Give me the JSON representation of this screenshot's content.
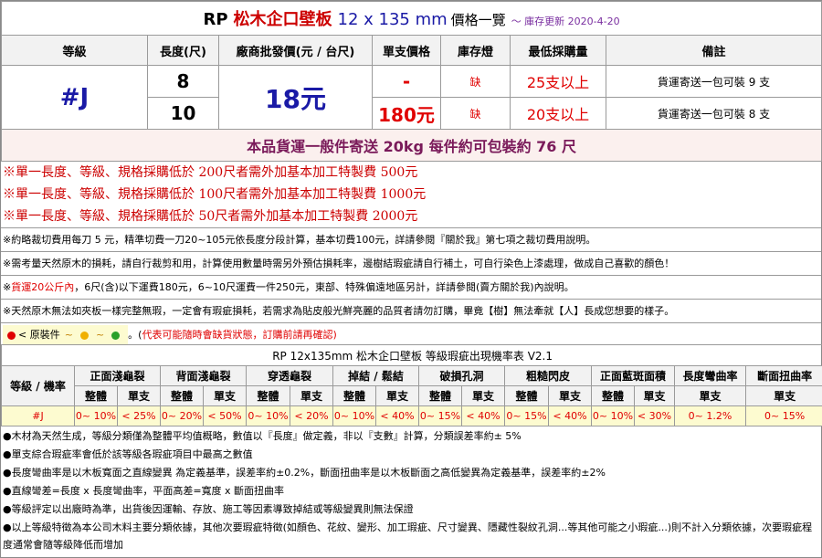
{
  "title": {
    "brand": "RP",
    "product": "松木企口壁板",
    "size": "12 x 135 mm",
    "suffix": "價格一覽",
    "date": "～ 庫存更新 2020-4-20"
  },
  "headers": [
    "等級",
    "長度(尺)",
    "廠商批發價(元 / 台尺)",
    "單支價格",
    "庫存燈",
    "最低採購量",
    "備註"
  ],
  "grade": "#J",
  "price_per_unit": "18元",
  "rows": [
    {
      "length": "8",
      "unit_price": "-",
      "stock": "缺",
      "min_qty": "25支以上",
      "note": "貨運寄送一包可裝 9 支"
    },
    {
      "length": "10",
      "unit_price": "180元",
      "stock": "缺",
      "min_qty": "20支以上",
      "note": "貨運寄送一包可裝 8 支"
    }
  ],
  "shipping": "本品貨運一般件寄送 20kg 每件約可包裝約 76 尺",
  "red_notes": [
    "※單一長度、等級、規格採購低於 200尺者需外加基本加工特製費 500元",
    "※單一長度、等級、規格採購低於 100尺者需外加基本加工特製費 1000元",
    "※單一長度、等級、規格採購低於  50尺者需外加基本加工特製費 2000元"
  ],
  "small_notes": [
    "※約略裁切費用每刀 5 元，精準切費一刀20~105元依長度分段計算，基本切費100元，詳請參閱『關於我』第七項之裁切費用說明。",
    "※需考量天然原木的損耗，請自行裁剪和用，計算使用數量時需另外預估損耗率，邊樹結瑕疵請自行補土，可自行染色上漆處理，做成自己喜歡的顏色！"
  ],
  "shipping_note": {
    "prefix": "※",
    "red": "貨運20公斤內",
    "rest": "，6尺(含)以下運費180元，6~10尺運費一件250元，東部、特殊偏遠地區另計，詳請參閱(賣方關於我)內說明。"
  },
  "wood_note": "※天然原木無法如夾板一樣完整無瑕，一定會有瑕疵損耗，若需求為貼皮般光鮮亮麗的品質者請勿訂購，畢竟【樹】無法牽就【人】長成您想要的樣子。",
  "legend": {
    "label": "< 原裝件",
    "tilde": "~",
    "note": "代表可能隨時會缺貨狀態，訂購前請再確認)",
    "note_prefix": "。(",
    "colors": {
      "red": "#e00000",
      "yellow": "#f0b000",
      "green": "#2aa02a"
    }
  },
  "rate_table": {
    "title": "RP 12x135mm 松木企口壁板 等級瑕疵出現機率表 V2.1",
    "grade_header": "等級 / 機率",
    "columns": [
      "正面淺龜裂",
      "背面淺龜裂",
      "穿透龜裂",
      "掉結 / 鬆結",
      "破損孔洞",
      "粗糙閃皮",
      "正面藍斑面積",
      "長度彎曲率",
      "斷面扭曲率"
    ],
    "sub_whole": "整體",
    "sub_single": "單支",
    "grade": "#J",
    "values": [
      "0~ 10%",
      "< 25%",
      "0~ 20%",
      "< 50%",
      "0~ 10%",
      "< 20%",
      "0~ 10%",
      "< 40%",
      "0~ 15%",
      "< 40%",
      "0~ 15%",
      "< 40%",
      "0~ 10%",
      "< 30%",
      "0~ 1.2%",
      "0~ 15%"
    ]
  },
  "footnotes": [
    "●木材為天然生成，等級分類僅為整體平均值概略，數值以『長度』做定義，非以『支數』計算，分類誤差率約± 5%",
    "●單支綜合瑕疵率會低於該等級各瑕疵項目中最高之數值",
    "●長度彎曲率是以木板寬面之直線變異 為定義基準，誤差率約±0.2%，斷面扭曲率是以木板斷面之高低變異為定義基準，誤差率約±2%",
    "●直線彎差=長度 x 長度彎曲率，平面高差=寬度 x 斷面扭曲率",
    "●等級評定以出廠時為準，出貨後因運輸、存放、施工等因素導致掉結或等級變異則無法保證",
    "●以上等級特徵為本公司木料主要分類依據，其他次要瑕疵特徵(如顏色、花紋、變形、加工瑕疵、尺寸變異、隱藏性裂紋孔洞...等其他可能之小瑕疵...)則不計入分類依據，次要瑕疵程度通常會隨等級降低而增加"
  ]
}
